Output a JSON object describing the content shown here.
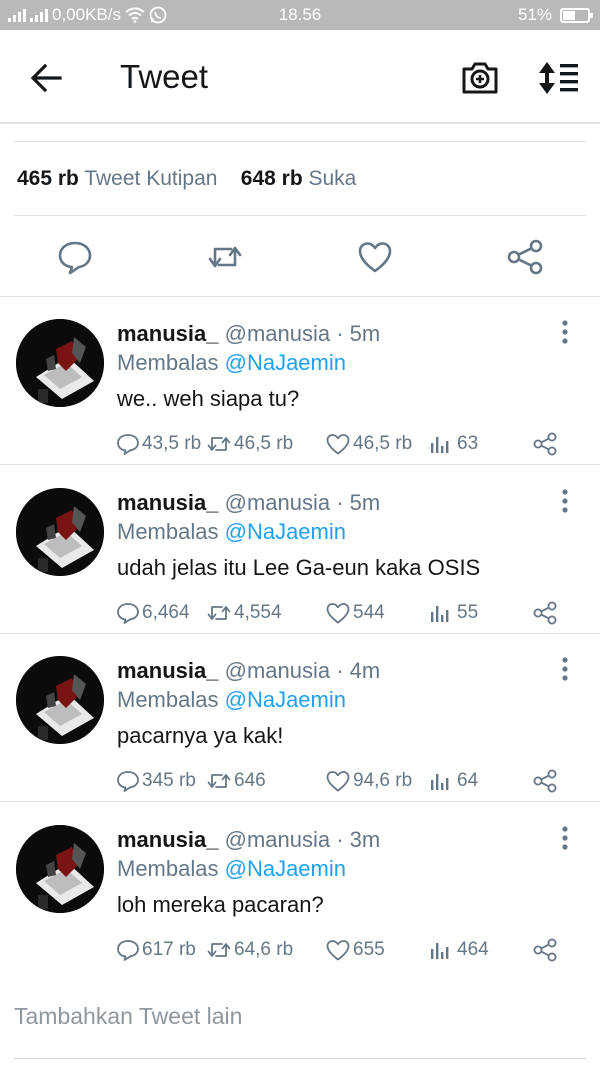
{
  "status_bar": {
    "network": "0,00KB/s",
    "time": "18.56",
    "battery": "51%",
    "battery_level": 0.51
  },
  "header": {
    "title": "Tweet"
  },
  "stats": {
    "quotes_count": "465 rb",
    "quotes_label": "Tweet Kutipan",
    "likes_count": "648 rb",
    "likes_label": "Suka"
  },
  "replies": [
    {
      "name": "manusia_",
      "meta": "@manusia · 5m",
      "replying_prefix": "Membalas",
      "replying_to": "@NaJaemin",
      "text": "we.. weh siapa tu?",
      "comments": "43,5 rb",
      "retweets": "46,5 rb",
      "likes": "46,5 rb",
      "views": "63"
    },
    {
      "name": "manusia_",
      "meta": "@manusia · 5m",
      "replying_prefix": "Membalas",
      "replying_to": "@NaJaemin",
      "text": "udah jelas itu Lee Ga-eun kaka OSIS",
      "comments": "6,464",
      "retweets": "4,554",
      "likes": "544",
      "views": "55"
    },
    {
      "name": "manusia_",
      "meta": "@manusia · 4m",
      "replying_prefix": "Membalas",
      "replying_to": "@NaJaemin",
      "text": "pacarnya ya kak!",
      "comments": "345 rb",
      "retweets": "646",
      "likes": "94,6 rb",
      "views": "64"
    },
    {
      "name": "manusia_",
      "meta": "@manusia · 3m",
      "replying_prefix": "Membalas",
      "replying_to": "@NaJaemin",
      "text": "loh mereka pacaran?",
      "comments": "617 rb",
      "retweets": "64,6 rb",
      "likes": "655",
      "views": "464"
    }
  ],
  "compose": {
    "placeholder": "Tambahkan Tweet lain"
  },
  "colors": {
    "accent": "#1da1f2",
    "secondary_text": "#657786",
    "primary_text": "#14171a",
    "status_bar": "#b9b9b9"
  }
}
